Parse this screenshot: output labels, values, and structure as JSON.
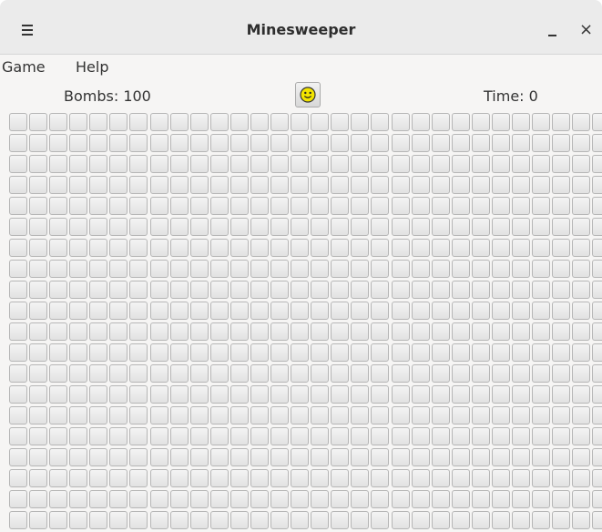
{
  "window": {
    "title": "Minesweeper",
    "close_glyph": "×"
  },
  "menubar": {
    "items": [
      {
        "label": "Game"
      },
      {
        "label": "Help"
      }
    ]
  },
  "status": {
    "bombs_text": "Bombs: 100",
    "time_text": "Time: 0",
    "smiley_icon": "smiley-face-icon"
  },
  "board": {
    "visible_columns": 30,
    "visible_rows": 20,
    "cell_state": "unrevealed"
  },
  "colors": {
    "smiley_face": "#f2e400",
    "cell_border": "#b6b6b6",
    "window_bg": "#f6f5f4"
  }
}
